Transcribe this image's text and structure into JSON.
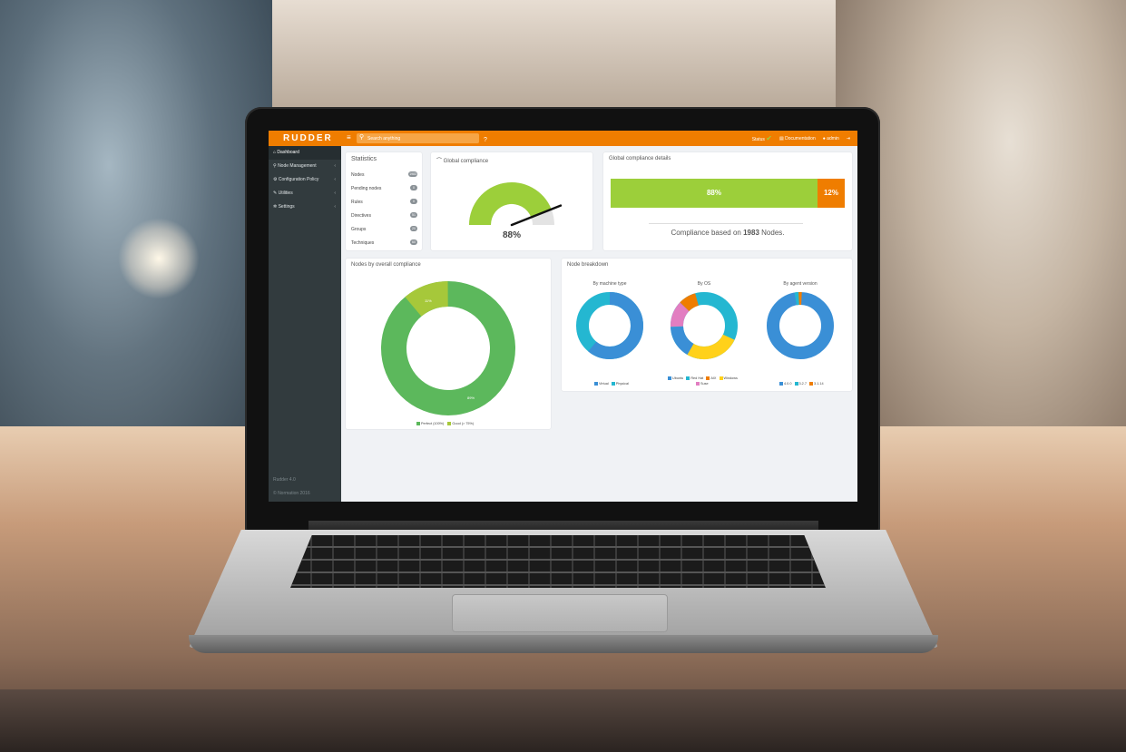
{
  "app": {
    "logo": "RUDDER",
    "search_placeholder": "Search anything",
    "nav_right": [
      "Status",
      "Documentation",
      "admin"
    ]
  },
  "sidebar": {
    "items": [
      {
        "label": "Dashboard",
        "active": true
      },
      {
        "label": "Node Management",
        "chevron": true
      },
      {
        "label": "Configuration Policy",
        "chevron": true
      },
      {
        "label": "Utilities",
        "chevron": true
      },
      {
        "label": "Settings",
        "chevron": true
      }
    ],
    "version": "Rudder 4.0",
    "copyright": "© Normation 2016"
  },
  "statistics": {
    "title": "Statistics",
    "rows": [
      {
        "label": "Nodes",
        "count": "1983"
      },
      {
        "label": "Pending nodes",
        "count": "0"
      },
      {
        "label": "Rules",
        "count": "0"
      },
      {
        "label": "Directives",
        "count": "51"
      },
      {
        "label": "Groups",
        "count": "20"
      },
      {
        "label": "Techniques",
        "count": "60"
      }
    ]
  },
  "global_compliance": {
    "title": "Global compliance",
    "value": "88%"
  },
  "compliance_details": {
    "title": "Global compliance details",
    "green": "88%",
    "orange": "12%",
    "note_prefix": "Compliance based on",
    "node_count": "1983",
    "note_suffix": "Nodes."
  },
  "nodes_by_compliance": {
    "title": "Nodes by overall compliance",
    "small_label": "11%",
    "large_label": "89%",
    "legend": [
      "Perfect (100%)",
      "Good (> 75%)"
    ]
  },
  "node_breakdown": {
    "title": "Node breakdown",
    "machine_type": {
      "title": "By machine type",
      "legend": [
        "Virtual",
        "Physical"
      ]
    },
    "os": {
      "title": "By OS",
      "legend": [
        "Ubuntu",
        "Red Hat",
        "AIX",
        "Windows",
        "Suse"
      ]
    },
    "agent": {
      "title": "By agent version",
      "legend": [
        "4.0.0",
        "3.2.7",
        "3.1.14"
      ]
    }
  },
  "colors": {
    "brand_orange": "#ef7d00",
    "compliance_green": "#9ccf3a",
    "perfect_green": "#5cb85c",
    "blue": "#3a8fd6",
    "cyan": "#24b7d1",
    "yellow": "#ffd11a",
    "pink": "#e27ec1"
  }
}
